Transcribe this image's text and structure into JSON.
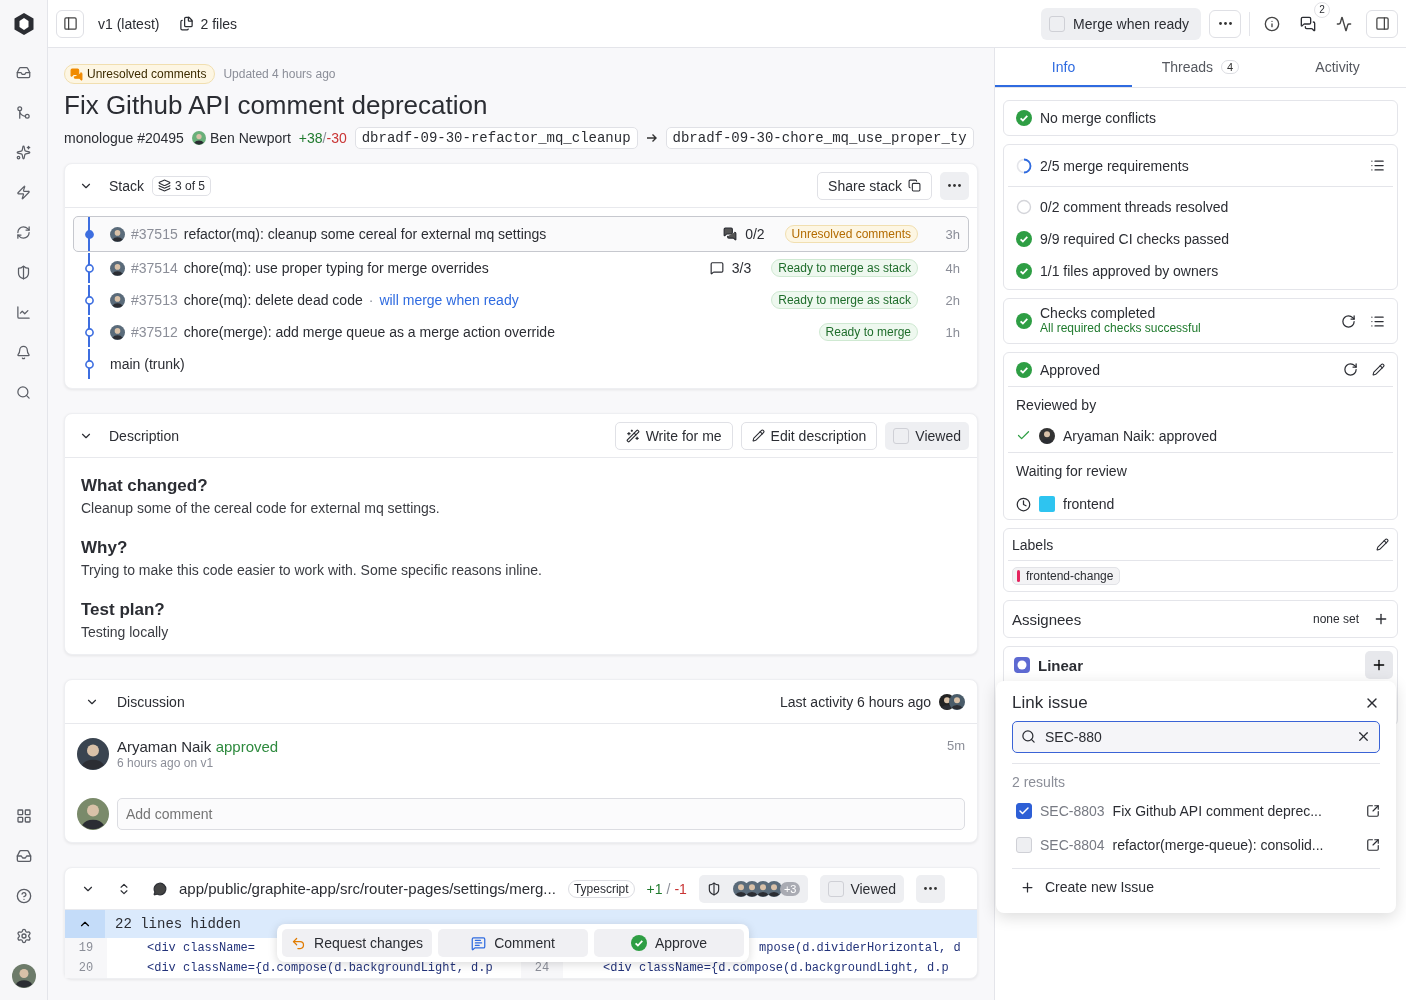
{
  "topbar": {
    "version": "v1 (latest)",
    "files": "2 files",
    "merge_when_ready": {
      "label": "Merge when ready",
      "checked": false
    },
    "threads_badge": "2"
  },
  "header": {
    "badge": "Unresolved comments",
    "updated": "Updated 4 hours ago",
    "title": "Fix Github API comment deprecation",
    "repo": "monologue #20495",
    "author": "Ben Newport",
    "additions": "+38",
    "separator": "/",
    "deletions": "-30",
    "from_branch": "dbradf-09-30-refactor_mq_cleanup",
    "to_branch": "dbradf-09-30-chore_mq_use_proper_ty"
  },
  "stack": {
    "title": "Stack",
    "count": "3 of 5",
    "share": "Share stack",
    "items": [
      {
        "number": "#37515",
        "title": "refactor(mq): cleanup some cereal for external mq settings",
        "comments": {
          "count": "0/2",
          "kind": "open"
        },
        "status": {
          "label": "Unresolved comments",
          "kind": "warning"
        },
        "age": "3h",
        "selected": true
      },
      {
        "number": "#37514",
        "title": "chore(mq): use proper typing for merge overrides",
        "comments": {
          "count": "3/3",
          "kind": "resolved"
        },
        "status": {
          "label": "Ready to merge as stack",
          "kind": "ready"
        },
        "age": "4h",
        "selected": false
      },
      {
        "number": "#37513",
        "title": "chore(mq): delete dead code",
        "separator": "·",
        "note": "will merge when ready",
        "status": {
          "label": "Ready to merge as stack",
          "kind": "ready"
        },
        "age": "2h",
        "selected": false
      },
      {
        "number": "#37512",
        "title": "chore(merge): add merge queue as a merge action override",
        "status": {
          "label": "Ready to merge",
          "kind": "ready"
        },
        "age": "1h",
        "selected": false
      }
    ],
    "trunk": "main (trunk)"
  },
  "description": {
    "title": "Description",
    "write": "Write for me",
    "edit": "Edit description",
    "viewed": {
      "label": "Viewed",
      "checked": false
    },
    "sections": [
      {
        "heading": "What changed?",
        "body": "Cleanup some of the cereal code for external mq settings."
      },
      {
        "heading": "Why?",
        "body": "Trying to make this code easier to work with. Some specific reasons inline."
      },
      {
        "heading": "Test plan?",
        "body": "Testing locally"
      }
    ]
  },
  "discussion": {
    "title": "Discussion",
    "last_activity": "Last activity 6 hours ago",
    "comments": [
      {
        "author": "Aryaman Naik",
        "action": "approved",
        "meta": "6 hours ago on v1",
        "age": "5m"
      }
    ],
    "placeholder": "Add comment"
  },
  "file": {
    "path": "app/public/graphite-app/src/router-pages/settings/merg...",
    "language": "Typescript",
    "additions": "+1",
    "separator": "/",
    "deletions": "-1",
    "extra_reviewers": "+3",
    "viewed": {
      "label": "Viewed",
      "checked": false
    },
    "hidden": "22 lines hidden",
    "lines": [
      {
        "left_number": "19",
        "left_code": "<div className=",
        "right_code": "mpose(d.dividerHorizontal, d"
      },
      {
        "left_number": "20",
        "left_code": "<div className={d.compose(d.backgroundLight, d.p",
        "right_number": "24",
        "right_code": "<div className={d.compose(d.backgroundLight, d.p"
      }
    ]
  },
  "review_bar": [
    {
      "label": "Request changes",
      "kind": "request"
    },
    {
      "label": "Comment",
      "kind": "comment"
    },
    {
      "label": "Approve",
      "kind": "approve"
    }
  ],
  "sidebar": {
    "tabs": [
      {
        "label": "Info",
        "selected": true
      },
      {
        "label": "Threads",
        "count": "4",
        "selected": false
      },
      {
        "label": "Activity",
        "selected": false
      }
    ],
    "conflicts": {
      "label": "No merge conflicts",
      "kind": "passed"
    },
    "requirements": {
      "label": "2/5 merge requirements",
      "kind": "pending",
      "items": [
        {
          "label": "0/2 comment threads resolved",
          "kind": "open"
        },
        {
          "label": "9/9 required CI checks passed",
          "kind": "passed"
        },
        {
          "label": "1/1 files approved by owners",
          "kind": "passed"
        }
      ]
    },
    "checks": {
      "title": "Checks completed",
      "subtitle": "All required checks successful",
      "kind": "passed"
    },
    "approval": {
      "title": "Approved",
      "kind": "passed",
      "reviewed_heading": "Reviewed by",
      "reviewers": [
        "Aryaman Naik: approved"
      ],
      "waiting_heading": "Waiting for review",
      "waiting": [
        "frontend"
      ]
    },
    "labels": {
      "title": "Labels",
      "items": [
        {
          "name": "frontend-change",
          "color": "#e5245e"
        }
      ]
    },
    "assignees": {
      "title": "Assignees",
      "value": "none set"
    },
    "linear": {
      "title": "Linear",
      "popover": {
        "title": "Link issue",
        "query": "SEC-880",
        "count": "2 results",
        "results": [
          {
            "id": "SEC-8803",
            "title": "Fix Github API comment deprec...",
            "checked": true
          },
          {
            "id": "SEC-8804",
            "title": "refactor(merge-queue): consolid...",
            "checked": false
          }
        ],
        "create": "Create new Issue"
      }
    }
  }
}
